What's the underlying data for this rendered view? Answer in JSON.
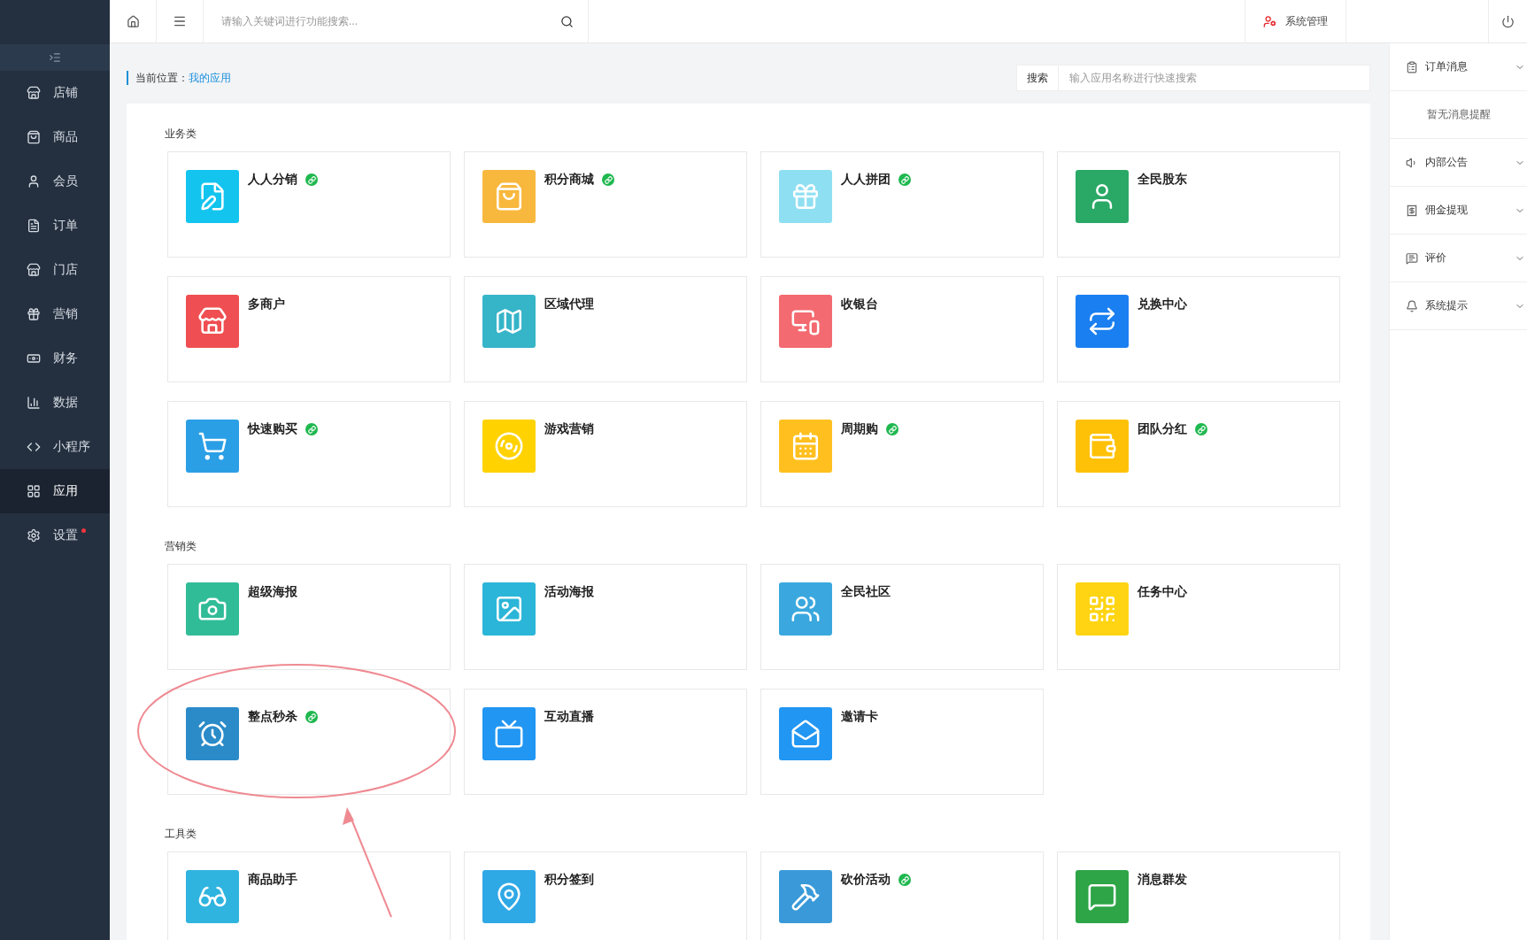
{
  "sidebar": {
    "items": [
      {
        "label": "店铺",
        "selected": false,
        "alert": false
      },
      {
        "label": "商品",
        "selected": false,
        "alert": false
      },
      {
        "label": "会员",
        "selected": false,
        "alert": false
      },
      {
        "label": "订单",
        "selected": false,
        "alert": false
      },
      {
        "label": "门店",
        "selected": false,
        "alert": false
      },
      {
        "label": "营销",
        "selected": false,
        "alert": false
      },
      {
        "label": "财务",
        "selected": false,
        "alert": false
      },
      {
        "label": "数据",
        "selected": false,
        "alert": false
      },
      {
        "label": "小程序",
        "selected": false,
        "alert": false
      },
      {
        "label": "应用",
        "selected": true,
        "alert": false
      },
      {
        "label": "设置",
        "selected": false,
        "alert": true
      }
    ]
  },
  "topbar": {
    "search": {
      "placeholder": "请输入关键词进行功能搜索..."
    },
    "admin_link": "系统管理"
  },
  "breadcrumb": {
    "label": "当前位置：",
    "current": "我的应用"
  },
  "app_search": {
    "button": "搜索",
    "placeholder": "输入应用名称进行快速搜索"
  },
  "sections": [
    {
      "title": "业务类",
      "apps": [
        {
          "name": "人人分销",
          "linked": true,
          "color": "#13c4ef"
        },
        {
          "name": "积分商城",
          "linked": true,
          "color": "#f8b83e"
        },
        {
          "name": "人人拼团",
          "linked": true,
          "color": "#8fdff2"
        },
        {
          "name": "全民股东",
          "linked": false,
          "color": "#2aa866"
        },
        {
          "name": "多商户",
          "linked": false,
          "color": "#ef4f52"
        },
        {
          "name": "区域代理",
          "linked": false,
          "color": "#36b4c8"
        },
        {
          "name": "收银台",
          "linked": false,
          "color": "#f36a70"
        },
        {
          "name": "兑换中心",
          "linked": false,
          "color": "#1a7ff0"
        },
        {
          "name": "快速购买",
          "linked": true,
          "color": "#2b9fe6"
        },
        {
          "name": "游戏营销",
          "linked": false,
          "color": "#ffd200"
        },
        {
          "name": "周期购",
          "linked": true,
          "color": "#ffc01f"
        },
        {
          "name": "团队分红",
          "linked": true,
          "color": "#ffc107"
        }
      ]
    },
    {
      "title": "营销类",
      "apps": [
        {
          "name": "超级海报",
          "linked": false,
          "color": "#31bc98"
        },
        {
          "name": "活动海报",
          "linked": false,
          "color": "#2bb5d8"
        },
        {
          "name": "全民社区",
          "linked": false,
          "color": "#3aa8de"
        },
        {
          "name": "任务中心",
          "linked": false,
          "color": "#ffd413"
        },
        {
          "name": "整点秒杀",
          "linked": true,
          "color": "#2b8bc9"
        },
        {
          "name": "互动直播",
          "linked": false,
          "color": "#2196f3"
        },
        {
          "name": "邀请卡",
          "linked": false,
          "color": "#2196f3"
        }
      ]
    },
    {
      "title": "工具类",
      "apps": [
        {
          "name": "商品助手",
          "linked": false,
          "color": "#2fb4e0"
        },
        {
          "name": "积分签到",
          "linked": false,
          "color": "#2fa8e6"
        },
        {
          "name": "砍价活动",
          "linked": true,
          "color": "#3a9ad9"
        },
        {
          "name": "消息群发",
          "linked": false,
          "color": "#2ea547"
        }
      ]
    }
  ],
  "notifications": [
    {
      "title": "订单消息",
      "empty_text": "暂无消息提醒"
    },
    {
      "title": "内部公告"
    },
    {
      "title": "佣金提现"
    },
    {
      "title": "评价"
    },
    {
      "title": "系统提示"
    }
  ]
}
